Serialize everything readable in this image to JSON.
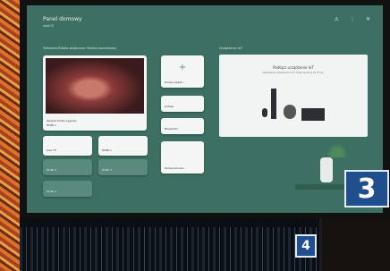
{
  "header": {
    "title": "Panel domowy",
    "subtitle": "webOS"
  },
  "sections": {
    "inputs_title": "Telewizor/Źródło wejściowe Telefon komórkowy",
    "devices_title": "Urządzenia IoT"
  },
  "tiles": {
    "live_label": "Zwykłe źródło sygnału",
    "live_sub": "HDMI 1",
    "add_label": "Dodaj urządz...",
    "airplay_label": "AirPlay",
    "bluetooth_label": "Bluetooth",
    "device_label": "Dodaj sieciow...",
    "livetv_label": "Live TV",
    "hdmi1_label": "HDMI 1",
    "hdmi2_label": "HDMI 2",
    "hdmi3_label": "HDMI 3",
    "hdmi4_label": "HDMI 4"
  },
  "iot_panel": {
    "title": "Podłącz urządzenie IoT",
    "desc": "Sterowanie urządzeniami IoT dzięki aplikacji LG ThinQ."
  },
  "badges": {
    "main": "3",
    "small": "4"
  },
  "icons": [
    "notification-icon",
    "settings-icon",
    "close-icon",
    "plus-icon"
  ]
}
